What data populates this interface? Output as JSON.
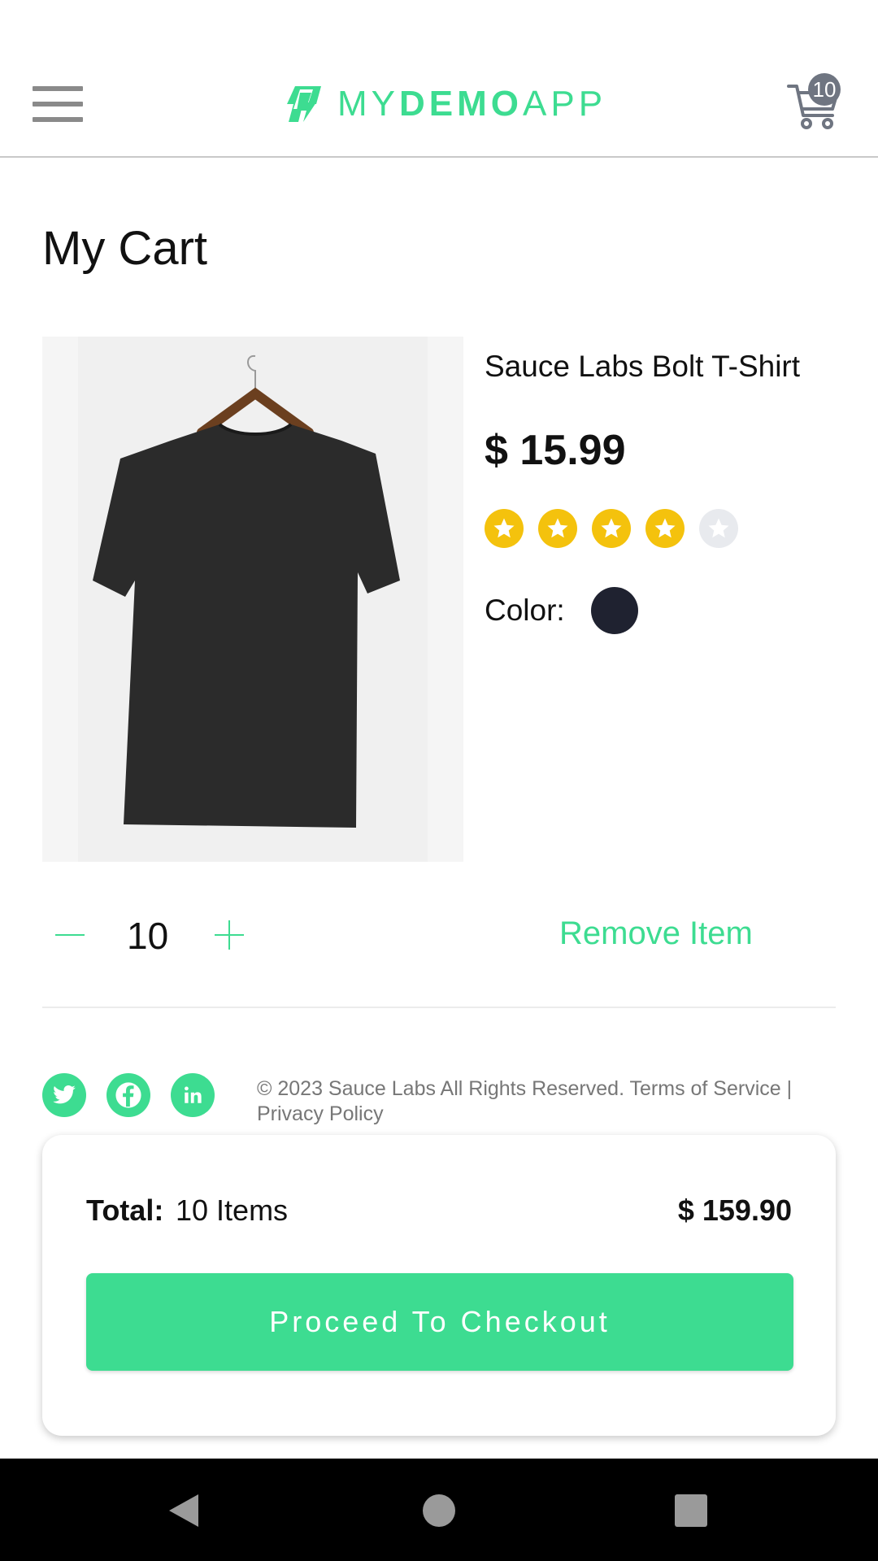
{
  "header": {
    "logo_my": "MY",
    "logo_demo": "DEMO",
    "logo_app": "APP",
    "cart_count": "10",
    "icons": {
      "menu": "hamburger-menu-icon",
      "cart": "shopping-cart-icon",
      "logo": "bolt-logo-icon"
    }
  },
  "page": {
    "title": "My Cart"
  },
  "product": {
    "name": "Sauce Labs Bolt T-Shirt",
    "price": "$ 15.99",
    "rating": 4,
    "rating_max": 5,
    "color_label": "Color:",
    "color_value": "#1f2230",
    "image": "black-t-shirt-on-hanger"
  },
  "quantity": {
    "value": "10",
    "minus_icon": "minus-icon",
    "plus_icon": "plus-icon"
  },
  "actions": {
    "remove_label": "Remove Item"
  },
  "footer": {
    "text": "© 2023 Sauce Labs All Rights Reserved. Terms of Service | Privacy Policy",
    "social": [
      "twitter-icon",
      "facebook-icon",
      "linkedin-icon"
    ]
  },
  "summary": {
    "total_label": "Total:",
    "items_label": "10 Items",
    "total_price": "$ 159.90",
    "checkout_label": "Proceed To Checkout"
  },
  "colors": {
    "accent": "#3ddc91",
    "star_filled": "#f4c20d",
    "star_empty": "#e8eaee",
    "badge": "#6f7581"
  },
  "system_nav": {
    "icons": [
      "back-icon",
      "home-icon",
      "recents-icon"
    ]
  }
}
